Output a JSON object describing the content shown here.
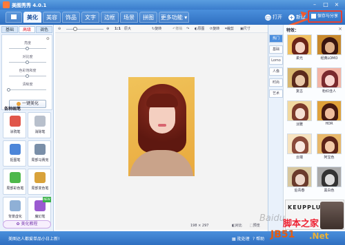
{
  "app": {
    "title": "美图秀秀 4.0.1"
  },
  "nav": {
    "tabs": [
      "美化",
      "美容",
      "饰品",
      "文字",
      "边框",
      "场景",
      "拼图",
      "更多功能 ▾"
    ],
    "open_label": "打开",
    "new_label": "新建",
    "save_label": "保存与分享"
  },
  "left": {
    "subtabs": [
      "基础",
      "高级",
      "调色"
    ],
    "sliders": [
      "亮度",
      "对比度",
      "色彩饱和度",
      "清晰度"
    ],
    "slider_levels": [
      0.5,
      0.5,
      0.5,
      0.0
    ],
    "onekey_label": "一键美化",
    "brush_title": "各种画笔",
    "brushes": [
      {
        "label": "涂鸦笔",
        "color": "#e0564a",
        "is_new": false
      },
      {
        "label": "消除笔",
        "color": "#b8c0cc",
        "is_new": false
      },
      {
        "label": "抠图笔",
        "color": "#4d86d9",
        "is_new": false
      },
      {
        "label": "局部马赛克",
        "color": "#7a8fa8",
        "is_new": false
      },
      {
        "label": "局部彩色笔",
        "color": "#4db84a",
        "is_new": false
      },
      {
        "label": "局部变色笔",
        "color": "#d9a23a",
        "is_new": false
      },
      {
        "label": "背景虚化",
        "color": "#8fb0d6",
        "is_new": false
      },
      {
        "label": "魔幻笔",
        "color": "#9a5ad0",
        "is_new": true
      }
    ],
    "new_badge": "NEW",
    "tutorial_label": "美化教程"
  },
  "toolbar": {
    "zoom_ratio": "1:1",
    "original_size": "原大",
    "rotate": "旋转",
    "undo": "撤销",
    "redo": "重做",
    "original": "原图",
    "rotate2": "旋转",
    "crop": "裁剪",
    "size": "尺寸"
  },
  "canvas": {
    "dimensions": "198 × 297",
    "compare_label": "对比",
    "preview_label": "预览"
  },
  "right": {
    "effects_title": "特效：",
    "categories": [
      "热门",
      "基础",
      "Lomo",
      "人像",
      "时尚",
      "艺术"
    ],
    "effects": [
      {
        "label": "柔光",
        "hair": "#6b2418",
        "bg": "#f0c060",
        "face": "#f6d3c2"
      },
      {
        "label": "经典LOMO",
        "hair": "#3a1510",
        "bg": "#c8892c",
        "face": "#e0b08a"
      },
      {
        "label": "复古",
        "hair": "#5a2a1c",
        "bg": "#d9b870",
        "face": "#e8c8a8"
      },
      {
        "label": "粉红佳人",
        "hair": "#7a2a2e",
        "bg": "#f3b6a6",
        "face": "#f9d6d0"
      },
      {
        "label": "淡雅",
        "hair": "#7c3a2a",
        "bg": "#f2d9a0",
        "face": "#f6e0d2"
      },
      {
        "label": "HDR",
        "hair": "#451910",
        "bg": "#e0a23a",
        "face": "#eebc9c"
      },
      {
        "label": "云端",
        "hair": "#8a4a3a",
        "bg": "#f7e3c0",
        "face": "#fae9e0"
      },
      {
        "label": "阿宝色",
        "hair": "#5c2418",
        "bg": "#e8b86a",
        "face": "#f3caa8"
      },
      {
        "label": "后青春",
        "hair": "#6a3b2c",
        "bg": "#d8c8a0",
        "face": "#ecd6c8"
      },
      {
        "label": "黑白色",
        "hair": "#333333",
        "bg": "#aaaaaa",
        "face": "#dddddd"
      }
    ],
    "ad_text": "KEUPPLUS"
  },
  "status": {
    "message": "美图达人都爱单品小日上新!",
    "batch_label": "批处理",
    "help_label": "帮助"
  },
  "watermark": {
    "a": "Baidu",
    "b": "脚本之家",
    "c": "JB51",
    "d": ".Net"
  }
}
